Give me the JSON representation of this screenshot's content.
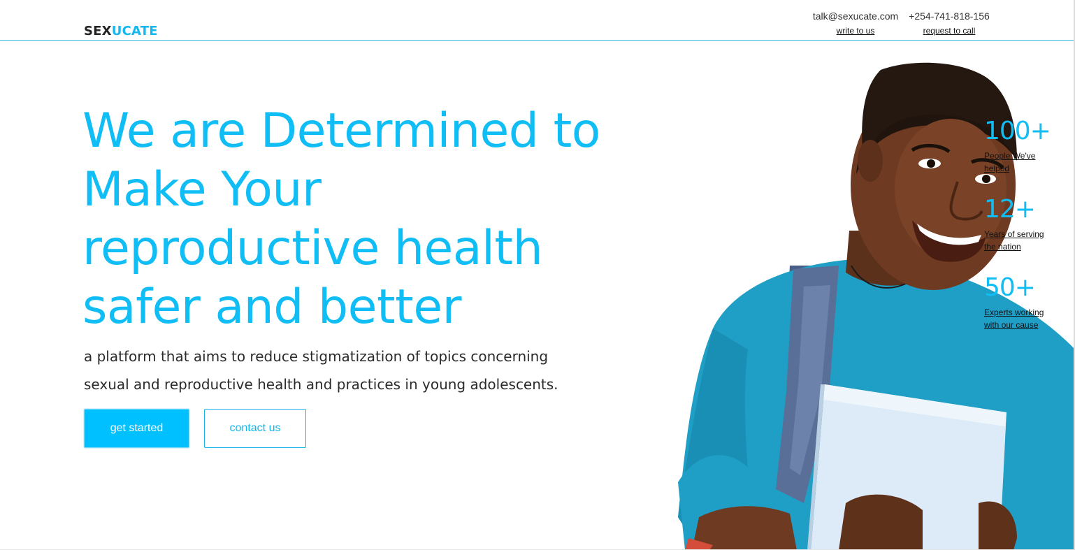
{
  "brand": {
    "part1": "SEX",
    "part2": "UCATE"
  },
  "header": {
    "email": "talk@sexucate.com",
    "email_link": "write to us",
    "phone": "+254-741-818-156",
    "phone_link": "request to call"
  },
  "hero": {
    "headline": "We are Determined to Make Your reproductive health safer and better",
    "subtitle": "a platform that aims to reduce stigmatization of topics concerning sexual and reproductive health and practices in young adolescents.",
    "primary_button": "get started",
    "secondary_button": "contact us"
  },
  "stats": [
    {
      "value": "100+",
      "label": "People We've helped"
    },
    {
      "value": "12+",
      "label": "Years of serving the nation"
    },
    {
      "value": "50+",
      "label": "Experts working with our cause"
    }
  ],
  "colors": {
    "accent": "#10bdf5",
    "shirt": "#1e9cc4",
    "skin": "#6b3a22"
  },
  "icons": {
    "illustration": "smiling-student-with-book"
  }
}
